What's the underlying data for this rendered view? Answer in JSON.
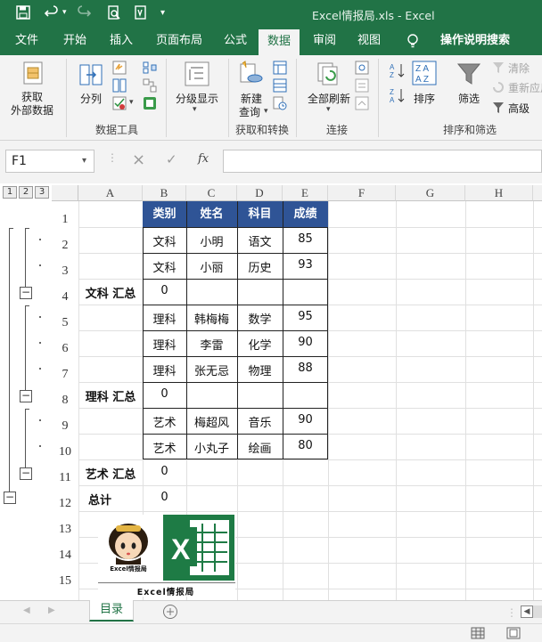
{
  "window": {
    "title": "Excel情报局.xls  -  Excel"
  },
  "tabs": [
    "文件",
    "开始",
    "插入",
    "页面布局",
    "公式",
    "数据",
    "审阅",
    "视图"
  ],
  "active_tab": "数据",
  "tell_me": "操作说明搜索",
  "ribbon": {
    "get_external": "获取\n外部数据",
    "get_external_l1": "获取",
    "get_external_l2": "外部数据",
    "split": "分列",
    "group_data_tools": "数据工具",
    "show_detail": "分级显示",
    "new_query_l1": "新建",
    "new_query_l2": "查询",
    "group_get_transform": "获取和转换",
    "refresh_all": "全部刷新",
    "group_connections": "连接",
    "sort": "排序",
    "filter": "筛选",
    "clear": "清除",
    "reapply": "重新应用",
    "advanced": "高级",
    "group_sort_filter": "排序和筛选"
  },
  "formula_bar": {
    "name_box": "F1",
    "cancel": "×",
    "enter": "✓",
    "fx": "fx",
    "value": ""
  },
  "outline_levels": [
    "1",
    "2",
    "3"
  ],
  "columns": [
    "A",
    "B",
    "C",
    "D",
    "E",
    "F",
    "G",
    "H"
  ],
  "rows": [
    "1",
    "2",
    "3",
    "4",
    "5",
    "6",
    "7",
    "8",
    "9",
    "10",
    "11",
    "12",
    "13",
    "14",
    "15"
  ],
  "table": {
    "headers": [
      "类别",
      "姓名",
      "科目",
      "成绩"
    ],
    "data": [
      [
        "文科",
        "小明",
        "语文",
        "85"
      ],
      [
        "文科",
        "小丽",
        "历史",
        "93"
      ],
      [
        "理科",
        "韩梅梅",
        "数学",
        "95"
      ],
      [
        "理科",
        "李雷",
        "化学",
        "90"
      ],
      [
        "理科",
        "张无忌",
        "物理",
        "88"
      ],
      [
        "艺术",
        "梅超风",
        "音乐",
        "90"
      ],
      [
        "艺术",
        "小丸子",
        "绘画",
        "80"
      ]
    ],
    "subtotals": [
      {
        "label": "文科 汇总",
        "value": "0"
      },
      {
        "label": "理科 汇总",
        "value": "0"
      },
      {
        "label": "艺术 汇总",
        "value": "0"
      },
      {
        "label": "总计",
        "value": "0"
      }
    ]
  },
  "logo": {
    "caption": "Excel情报局",
    "small_caption": "Excel情报局"
  },
  "sheet_tabs": [
    "目录"
  ],
  "colors": {
    "excel_green": "#217346",
    "header_blue": "#2f5496"
  }
}
